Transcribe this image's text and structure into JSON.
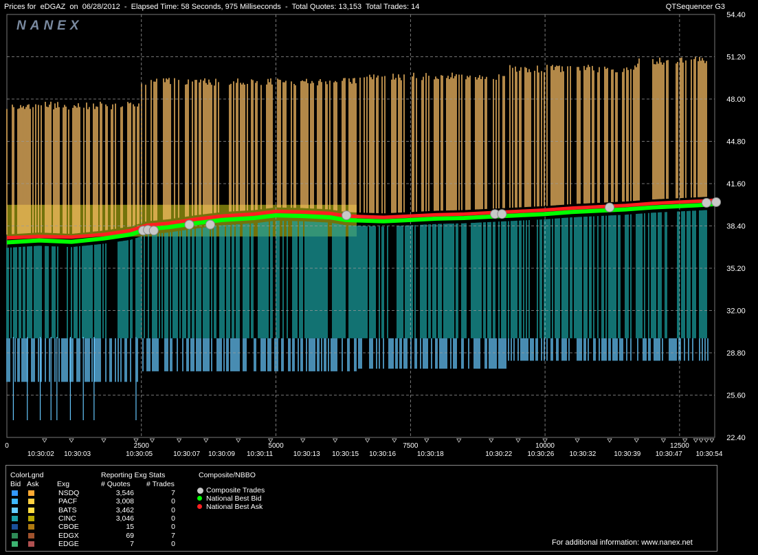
{
  "header": {
    "left_text": "Prices for  eDGAZ  on  06/28/2012  -  Elapsed Time: 58 Seconds, 975 Milliseconds  -  Total Quotes: 13,153  Total Trades: 14",
    "right_text": "QTSequencer G3",
    "logo": "NANEX"
  },
  "chart_data": {
    "type": "line",
    "x_axis": {
      "range": [
        0,
        13153
      ],
      "count_ticks": [
        "0",
        "2500",
        "5000",
        "7500",
        "10000",
        "12500"
      ],
      "count_values": [
        0,
        2500,
        5000,
        7500,
        10000,
        12500
      ],
      "time_labels": [
        "10:30:02",
        "10:30:03",
        "10:30:05",
        "10:30:07",
        "10:30:09",
        "10:30:11",
        "10:30:13",
        "10:30:15",
        "10:30:16",
        "10:30:18",
        "10:30:22",
        "10:30:26",
        "10:30:32",
        "10:30:39",
        "10:30:47",
        "10:30:54"
      ],
      "time_positions": [
        630,
        1310,
        2460,
        3340,
        3990,
        4700,
        5570,
        6290,
        6980,
        7870,
        9140,
        9920,
        10700,
        11530,
        12300,
        13050
      ]
    },
    "y_axis": {
      "range": [
        22.4,
        54.4
      ],
      "ticks": [
        "54.40",
        "51.20",
        "48.00",
        "44.80",
        "41.60",
        "38.40",
        "35.20",
        "32.00",
        "28.80",
        "25.60",
        "22.40"
      ],
      "tick_values": [
        54.4,
        51.2,
        48.0,
        44.8,
        41.6,
        38.4,
        35.2,
        32.0,
        28.8,
        25.6,
        22.4
      ]
    },
    "grid": true,
    "series": [
      {
        "name": "National Best Bid",
        "color": "#00ff00",
        "x": [
          0,
          600,
          1200,
          1800,
          2300,
          2600,
          3000,
          3500,
          4000,
          4600,
          5000,
          5500,
          6000,
          6300,
          6600,
          7000,
          7500,
          8000,
          8500,
          9000,
          9500,
          10000,
          10500,
          11000,
          11500,
          12000,
          12500,
          13000,
          13150
        ],
        "y": [
          37.15,
          37.3,
          37.2,
          37.45,
          37.75,
          38.15,
          38.3,
          38.6,
          38.85,
          39.0,
          39.2,
          39.15,
          39.05,
          38.85,
          38.8,
          38.75,
          38.85,
          38.95,
          39.0,
          39.1,
          39.2,
          39.3,
          39.45,
          39.55,
          39.65,
          39.8,
          39.9,
          40.0,
          40.05
        ]
      },
      {
        "name": "National Best Ask",
        "color": "#ff2020",
        "x": [
          0,
          600,
          1200,
          1800,
          2300,
          2600,
          3000,
          3500,
          4000,
          4600,
          5000,
          5500,
          6000,
          6300,
          6600,
          7000,
          7500,
          8000,
          8500,
          9000,
          9500,
          10000,
          10500,
          11000,
          11500,
          12000,
          12500,
          13000,
          13150
        ],
        "y": [
          37.5,
          37.6,
          37.55,
          37.75,
          38.05,
          38.45,
          38.6,
          38.9,
          39.15,
          39.3,
          39.5,
          39.45,
          39.35,
          39.15,
          39.1,
          39.05,
          39.15,
          39.25,
          39.3,
          39.4,
          39.5,
          39.6,
          39.75,
          39.85,
          39.95,
          40.1,
          40.2,
          40.3,
          40.35
        ]
      },
      {
        "name": "Composite Trades",
        "color": "#c8c8c8",
        "x": [
          2530,
          2620,
          2730,
          3390,
          3780,
          6310,
          9070,
          9200,
          11200,
          13000,
          13180
        ],
        "y": [
          38.05,
          38.1,
          38.05,
          38.5,
          38.5,
          39.2,
          39.3,
          39.3,
          39.8,
          40.15,
          40.2
        ]
      }
    ]
  },
  "legend": {
    "color_legend_title": "ColorLgnd",
    "bid_label": "Bid",
    "ask_label": "Ask",
    "exg_label": "Exg",
    "stats_title": "Reporting Exg Stats",
    "quotes_header": "# Quotes",
    "trades_header": "# Trades",
    "composite_title": "Composite/NBBO",
    "exchanges": [
      {
        "name": "NSDQ",
        "quotes": "3,546",
        "trades": "7",
        "bid_color": "#3399ff",
        "ask_color": "#ffaa33"
      },
      {
        "name": "PACF",
        "quotes": "3,008",
        "trades": "0",
        "bid_color": "#3db8ff",
        "ask_color": "#ffd040"
      },
      {
        "name": "BATS",
        "quotes": "3,462",
        "trades": "0",
        "bid_color": "#66ccff",
        "ask_color": "#ffdd44"
      },
      {
        "name": "CINC",
        "quotes": "3,046",
        "trades": "0",
        "bid_color": "#1a9fa8",
        "ask_color": "#b8a800"
      },
      {
        "name": "CBOE",
        "quotes": "15",
        "trades": "0",
        "bid_color": "#1a4f9a",
        "ask_color": "#b07a10"
      },
      {
        "name": "EDGX",
        "quotes": "69",
        "trades": "7",
        "bid_color": "#2e8b57",
        "ask_color": "#a0522d"
      },
      {
        "name": "EDGE",
        "quotes": "7",
        "trades": "0",
        "bid_color": "#3cb371",
        "ask_color": "#b05050"
      }
    ],
    "composite_items": [
      {
        "label": "Composite Trades",
        "color": "#c8c8c8"
      },
      {
        "label": "National Best Bid",
        "color": "#00ff00"
      },
      {
        "label": "National Best Ask",
        "color": "#ff2020"
      }
    ],
    "footer": "For additional information: www.nanex.net"
  },
  "colors": {
    "ask_orange": "#ffc266",
    "bid_teal": "#1aa3a3",
    "bid_lightblue": "#66c8ff",
    "olive": "#9a9a10",
    "grid": "#9a9a9a"
  }
}
